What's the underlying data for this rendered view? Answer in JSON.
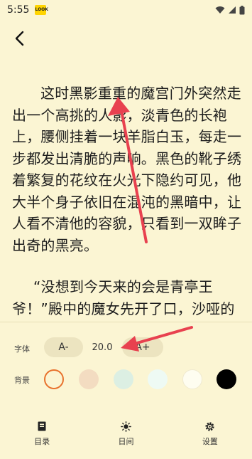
{
  "status_bar": {
    "time": "5:55",
    "badge_text": "LOOK"
  },
  "reader": {
    "paragraphs": [
      "这时黑影重重的魔宫门外突然走出一个高挑的人影，淡青色的长袍上，腰侧挂着一块羊脂白玉，每走一步都发出清脆的声响。黑色的靴子绣着繁复的花纹在火光下隐约可见，他大半个身子依旧在混沌的黑暗中，让人看不清他的容貌，只看到一双眸子出奇的黑亮。",
      "“没想到今天来的会是青亭王爷！”殿中的魔女先开了口，沙哑的声"
    ]
  },
  "settings": {
    "font_label": "字体",
    "font_decrease": "A-",
    "font_size_value": "20.0",
    "font_increase": "A+",
    "bg_label": "背景",
    "swatches": [
      "#fbf5d3",
      "#f3dcc1",
      "#dcefe3",
      "#eefaf4",
      "#fefdf0",
      "#000000"
    ],
    "selected_swatch_color": "#e8722d"
  },
  "bottom_nav": {
    "toc_label": "目录",
    "day_label": "日间",
    "settings_label": "设置"
  },
  "colors": {
    "background": "#fbf5d3",
    "annotation_arrow": "#e8414f"
  }
}
